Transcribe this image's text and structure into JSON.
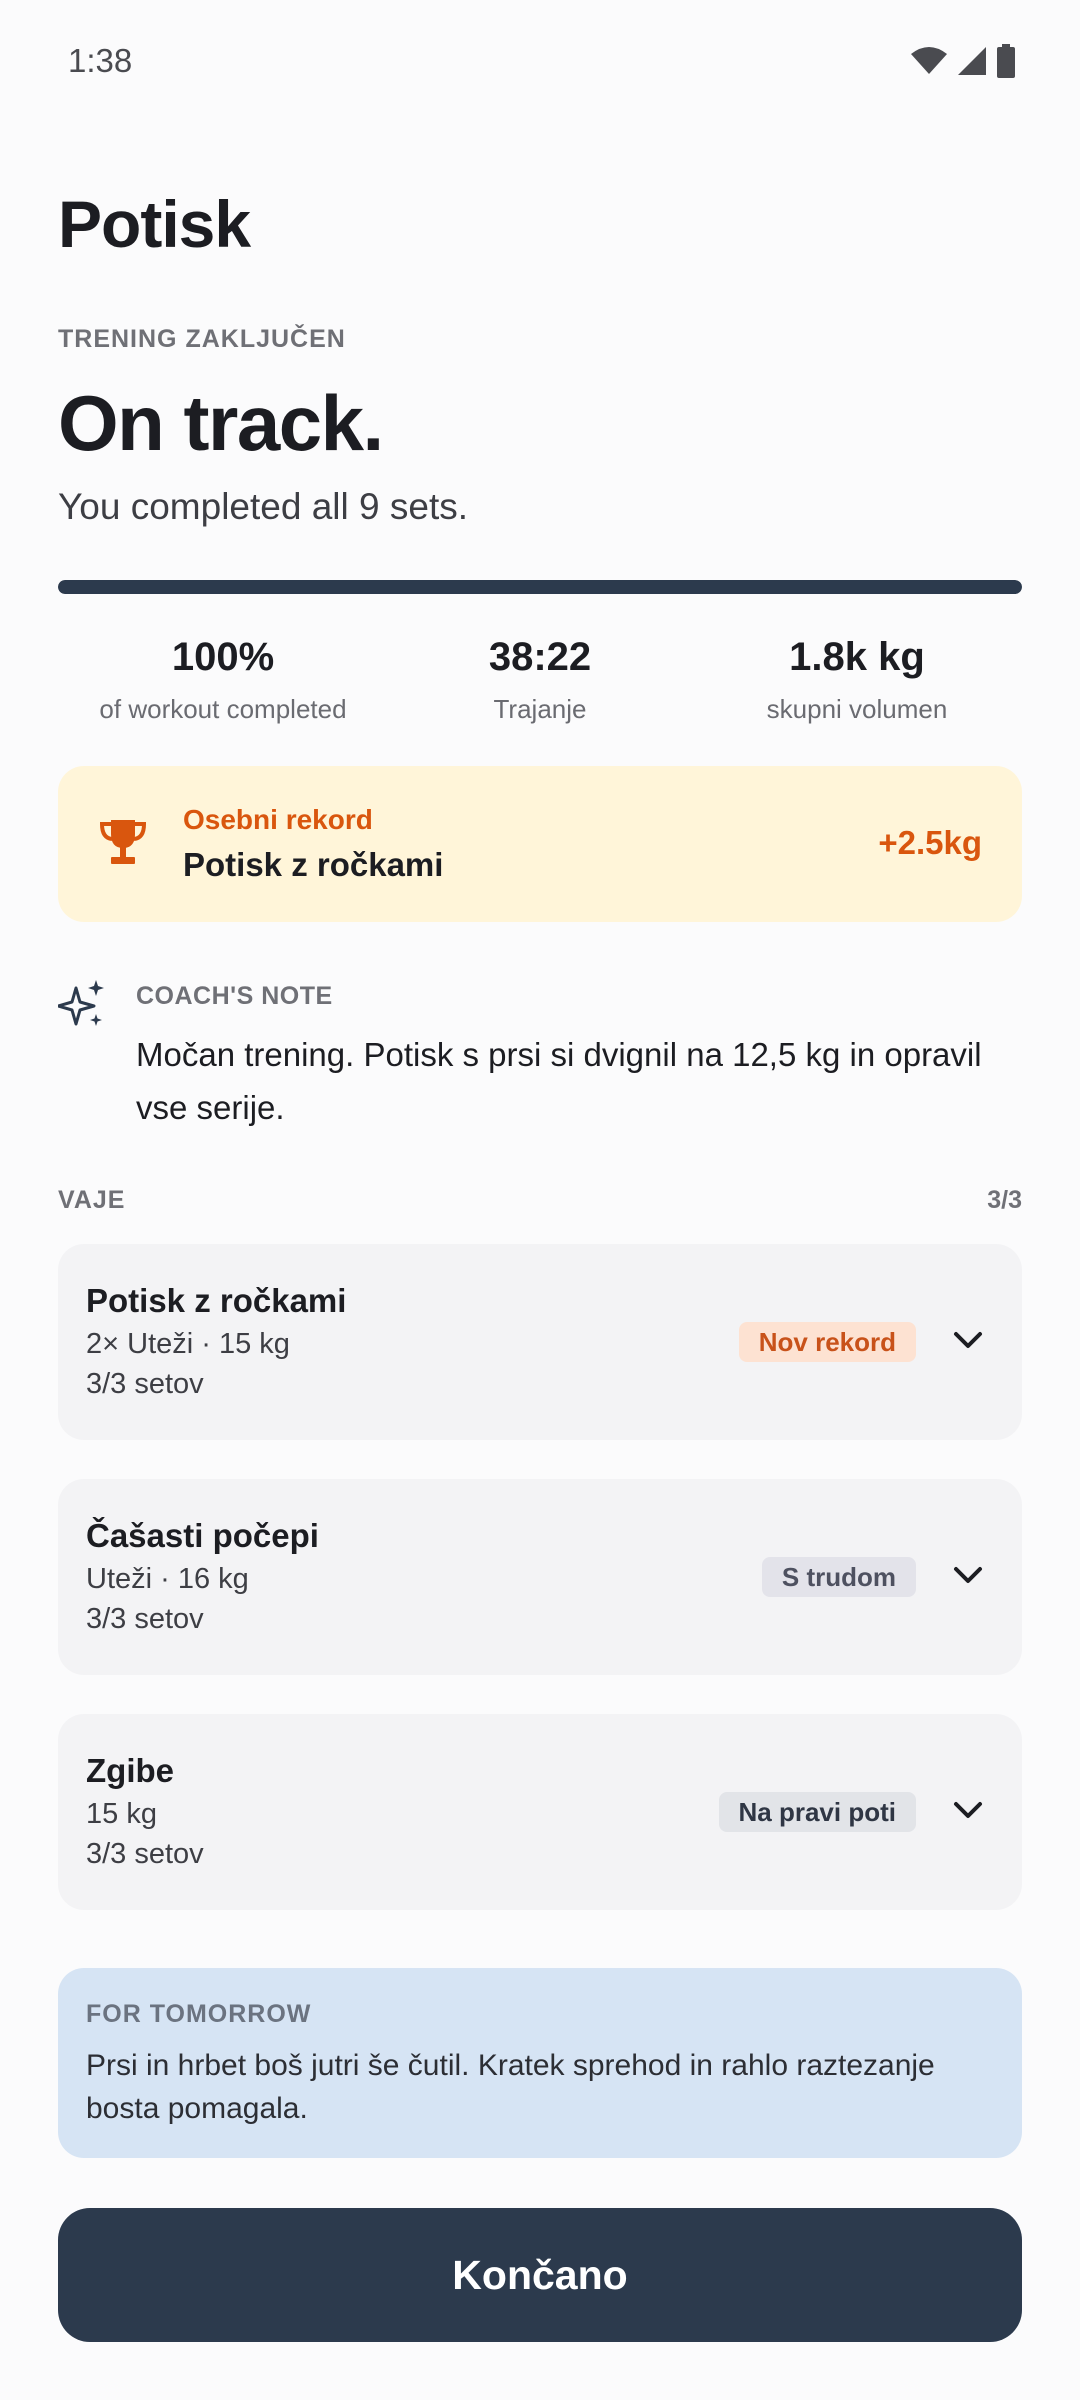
{
  "status_bar": {
    "time": "1:38"
  },
  "header": {
    "title": "Potisk"
  },
  "summary": {
    "eyebrow": "TRENING ZAKLJUČEN",
    "headline": "On track.",
    "subhead": "You completed all 9 sets.",
    "progress_percent": 100
  },
  "stats": [
    {
      "value": "100%",
      "label": "of workout completed"
    },
    {
      "value": "38:22",
      "label": "Trajanje"
    },
    {
      "value": "1.8k kg",
      "label": "skupni volumen"
    }
  ],
  "record": {
    "eyebrow": "Osebni rekord",
    "exercise": "Potisk z ročkami",
    "delta": "+2.5kg",
    "accent_color": "#d9560e"
  },
  "coach": {
    "label": "COACH'S NOTE",
    "text": "Močan trening. Potisk s prsi si dvignil na 12,5 kg in opravil vse serije."
  },
  "exercises_section": {
    "label": "VAJE",
    "count": "3/3"
  },
  "exercises": [
    {
      "name": "Potisk z ročkami",
      "detail": "2× Uteži · 15 kg",
      "sets": "3/3 setov",
      "badge": "Nov rekord"
    },
    {
      "name": "Čašasti počepi",
      "detail": "Uteži · 16 kg",
      "sets": "3/3 setov",
      "badge": "S trudom"
    },
    {
      "name": "Zgibe",
      "detail": "15 kg",
      "sets": "3/3 setov",
      "badge": "Na pravi poti"
    }
  ],
  "tomorrow": {
    "label": "FOR TOMORROW",
    "text": "Prsi in hrbet boš jutri še čutil. Kratek sprehod in rahlo raztezanje bosta pomagala."
  },
  "actions": {
    "done_label": "Končano"
  },
  "icons": {
    "wifi": "wifi-icon",
    "signal": "signal-icon",
    "battery": "battery-icon",
    "trophy": "trophy-icon",
    "sparkle": "sparkle-icon",
    "chevron": "chevron-down-icon"
  },
  "colors": {
    "primary": "#2c3a4d",
    "record_bg": "#fff5d9",
    "tomorrow_bg": "#d6e4f4"
  }
}
